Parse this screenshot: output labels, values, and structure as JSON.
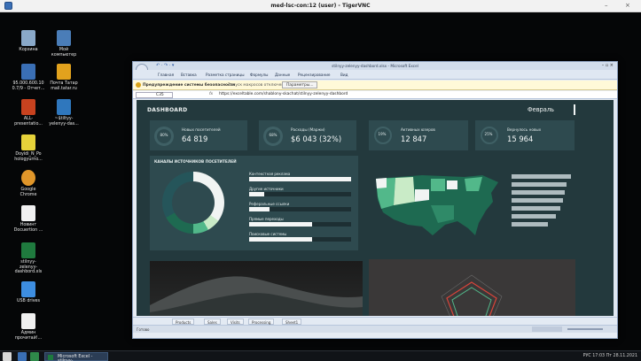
{
  "vnc": {
    "title": "med-lsc-con:12 (user) - TigerVNC",
    "minimize": "–",
    "close": "×"
  },
  "desktop_icons": [
    {
      "label": "Корзина",
      "color": "#8aa9c9"
    },
    {
      "label": "Мой\nкомпьютер",
      "color": "#4a7db8"
    },
    {
      "label": "95.000.600.10\n0.7/9 - Отчет...",
      "color": "#3a6fb5"
    },
    {
      "label": "Почта Татар\nmail.tatar.ru",
      "color": "#e2a21d"
    },
    {
      "label": "ALL-\npresentatio...",
      "color": "#c8421f"
    },
    {
      "label": "~$tiltyy-\nyelenyy-das...",
      "color": "#2f77bd"
    },
    {
      "label": "Doyidi_N_Po\nhologyurno...",
      "color": "#e6d23a"
    },
    {
      "label": "Google\nChrome",
      "color": "#e0962a"
    },
    {
      "label": "Новинт\nDocuertion ...",
      "color": "#f0f0f0"
    },
    {
      "label": "stilnyy-\nzelenyy-\ndashbord.xls",
      "color": "#1f7a3e"
    },
    {
      "label": "USB drives",
      "color": "#3d8de0"
    },
    {
      "label": "Админ\nпрочитай!...",
      "color": "#f0f0f0"
    }
  ],
  "taskbar": {
    "item": "Microsoft Excel - stilnyy-...",
    "tray": "РУС   17:03   Пт 28.11.2021"
  },
  "excel": {
    "window_title": "stilnyy-zelenyy-dashbord.xlsx - Microsoft Excel",
    "qat": "↶ · ↷ · ▾",
    "controls": "– ▫ ×",
    "ribbon_tabs": [
      "Главная",
      "Вставка",
      "Разметка страницы",
      "Формулы",
      "Данные",
      "Рецензирование",
      "Вид"
    ],
    "security": {
      "warning": "Предупреждение системы безопасности",
      "message": "Запуск макросов отключен.",
      "button": "Параметры..."
    },
    "name_box": "C35",
    "fx": "fx",
    "formula": "https://exceltable.com/shablony-skachat/stilnyy-zelenyy-dashbord",
    "sheet_tabs": [
      "Products",
      "Sales",
      "Visits",
      "Processing",
      "Sheet1"
    ],
    "status": "Готово"
  },
  "dashboard": {
    "title": "DASHBOARD",
    "month": "Февраль",
    "kpis": [
      {
        "label": "Новых посетителей",
        "value": "64 819",
        "pct": "80%",
        "ring": 0.8
      },
      {
        "label": "Расходы (Маржи)",
        "value": "$6 043 (32%)",
        "pct": "68%",
        "ring": 0.68
      },
      {
        "label": "Активных юзеров",
        "value": "12 847",
        "pct": "19%",
        "ring": 0.19
      },
      {
        "label": "Вернулось новых",
        "value": "15 964",
        "pct": "25%",
        "ring": 0.25
      }
    ],
    "channels": {
      "title": "КАНАЛЫ ИСТОЧНИКОВ ПОСЕТИТЕЛЕЙ",
      "items": [
        {
          "label": "Контекстная реклама",
          "value": 1.0
        },
        {
          "label": "Другие источники",
          "value": 0.15
        },
        {
          "label": "Реферальные ссылки",
          "value": 0.2
        },
        {
          "label": "Прямые переходы",
          "value": 0.62
        },
        {
          "label": "Поисковые системы",
          "value": 0.62
        }
      ]
    },
    "right_bars": [
      0.56,
      0.52,
      0.5,
      0.48,
      0.46,
      0.42,
      0.34
    ],
    "colors": {
      "bg": "#23393d",
      "card": "#2e4a4f",
      "accent": "#52b88a",
      "light": "#c9ebc7"
    }
  }
}
